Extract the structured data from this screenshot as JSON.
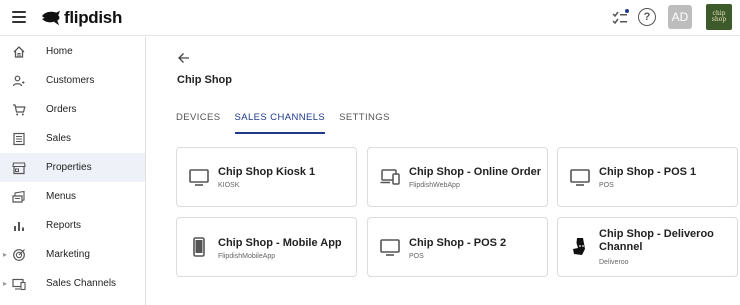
{
  "app": {
    "brand": "flipdish",
    "avatar_initials": "AD",
    "store_logo_text": "chip shop"
  },
  "icons": {
    "menu": "hamburger-icon",
    "checklist": "checklist-icon",
    "help": "help-icon"
  },
  "sidebar": {
    "items": [
      {
        "label": "Home",
        "icon": "home-icon",
        "active": false,
        "expandable": false
      },
      {
        "label": "Customers",
        "icon": "customers-icon",
        "active": false,
        "expandable": false
      },
      {
        "label": "Orders",
        "icon": "cart-icon",
        "active": false,
        "expandable": false
      },
      {
        "label": "Sales",
        "icon": "sales-icon",
        "active": false,
        "expandable": false
      },
      {
        "label": "Properties",
        "icon": "store-icon",
        "active": true,
        "expandable": false
      },
      {
        "label": "Menus",
        "icon": "menus-icon",
        "active": false,
        "expandable": false
      },
      {
        "label": "Reports",
        "icon": "reports-icon",
        "active": false,
        "expandable": false
      },
      {
        "label": "Marketing",
        "icon": "marketing-icon",
        "active": false,
        "expandable": true
      },
      {
        "label": "Sales Channels",
        "icon": "sales-channels-icon",
        "active": false,
        "expandable": true
      }
    ]
  },
  "main": {
    "title": "Chip Shop",
    "tabs": [
      {
        "label": "DEVICES",
        "active": false
      },
      {
        "label": "SALES CHANNELS",
        "active": true
      },
      {
        "label": "SETTINGS",
        "active": false
      }
    ],
    "cards": [
      {
        "title": "Chip Shop Kiosk 1",
        "subtitle": "KIOSK",
        "icon": "monitor-icon"
      },
      {
        "title": "Chip Shop - Online Order",
        "subtitle": "FlipdishWebApp",
        "icon": "devices-icon"
      },
      {
        "title": "Chip Shop - POS 1",
        "subtitle": "POS",
        "icon": "monitor-icon"
      },
      {
        "title": "Chip Shop - Mobile App",
        "subtitle": "FlipdishMobileApp",
        "icon": "smartphone-icon"
      },
      {
        "title": "Chip Shop - POS 2",
        "subtitle": "POS",
        "icon": "monitor-icon"
      },
      {
        "title": "Chip Shop - Deliveroo Channel",
        "subtitle": "Deliveroo",
        "icon": "deliveroo-icon"
      }
    ]
  },
  "colors": {
    "accent": "#1d3a8a",
    "active_nav_bg": "#eef1f8",
    "avatar_bg": "#bdbdbd",
    "notification_dot": "#1d3a8a"
  }
}
